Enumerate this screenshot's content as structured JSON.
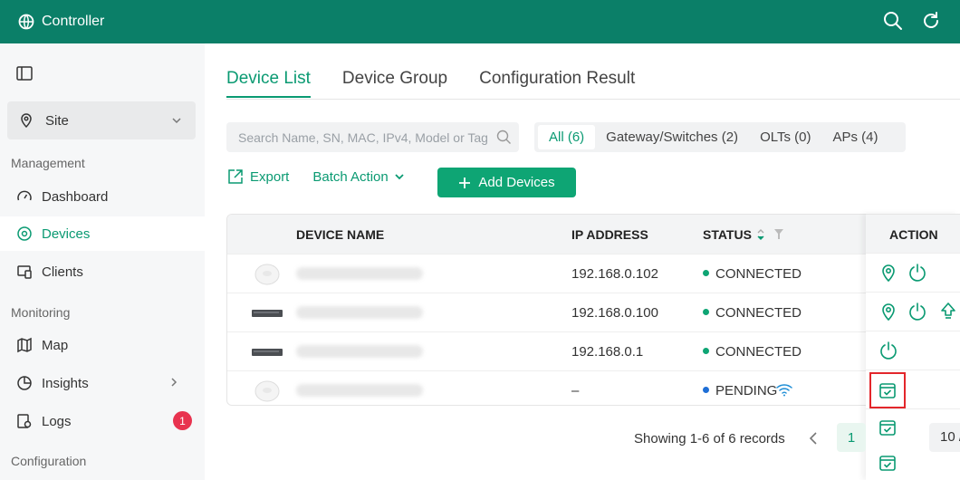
{
  "app": {
    "title": "Controller"
  },
  "sidebar": {
    "site_label": "Site",
    "sections": {
      "management": "Management",
      "monitoring": "Monitoring",
      "configuration": "Configuration"
    },
    "items": [
      {
        "label": "Dashboard"
      },
      {
        "label": "Devices"
      },
      {
        "label": "Clients"
      },
      {
        "label": "Map"
      },
      {
        "label": "Insights"
      },
      {
        "label": "Logs",
        "badge": "1"
      }
    ]
  },
  "tabs": [
    {
      "label": "Device List"
    },
    {
      "label": "Device Group"
    },
    {
      "label": "Configuration Result"
    }
  ],
  "search": {
    "placeholder": "Search Name, SN, MAC, IPv4, Model or Tag"
  },
  "filters": [
    {
      "label": "All (6)"
    },
    {
      "label": "Gateway/Switches (2)"
    },
    {
      "label": "OLTs (0)"
    },
    {
      "label": "APs (4)"
    }
  ],
  "toolbar": {
    "export_label": "Export",
    "batch_label": "Batch Action",
    "add_label": "Add Devices"
  },
  "table": {
    "headers": {
      "name": "DEVICE NAME",
      "ip": "IP ADDRESS",
      "status": "STATUS",
      "action": "ACTION"
    },
    "rows": [
      {
        "ip": "192.168.0.102",
        "status": "CONNECTED"
      },
      {
        "ip": "192.168.0.100",
        "status": "CONNECTED"
      },
      {
        "ip": "192.168.0.1",
        "status": "CONNECTED"
      },
      {
        "ip": "–",
        "status": "PENDING"
      }
    ]
  },
  "pagination": {
    "summary": "Showing 1-6 of 6 records",
    "page": "1",
    "page_size": "10 /"
  },
  "colors": {
    "brand": "#0b7f68",
    "accent": "#0a9a72",
    "connected": "#0ea574",
    "pending": "#1f6fd6",
    "highlight": "#e3262b"
  }
}
